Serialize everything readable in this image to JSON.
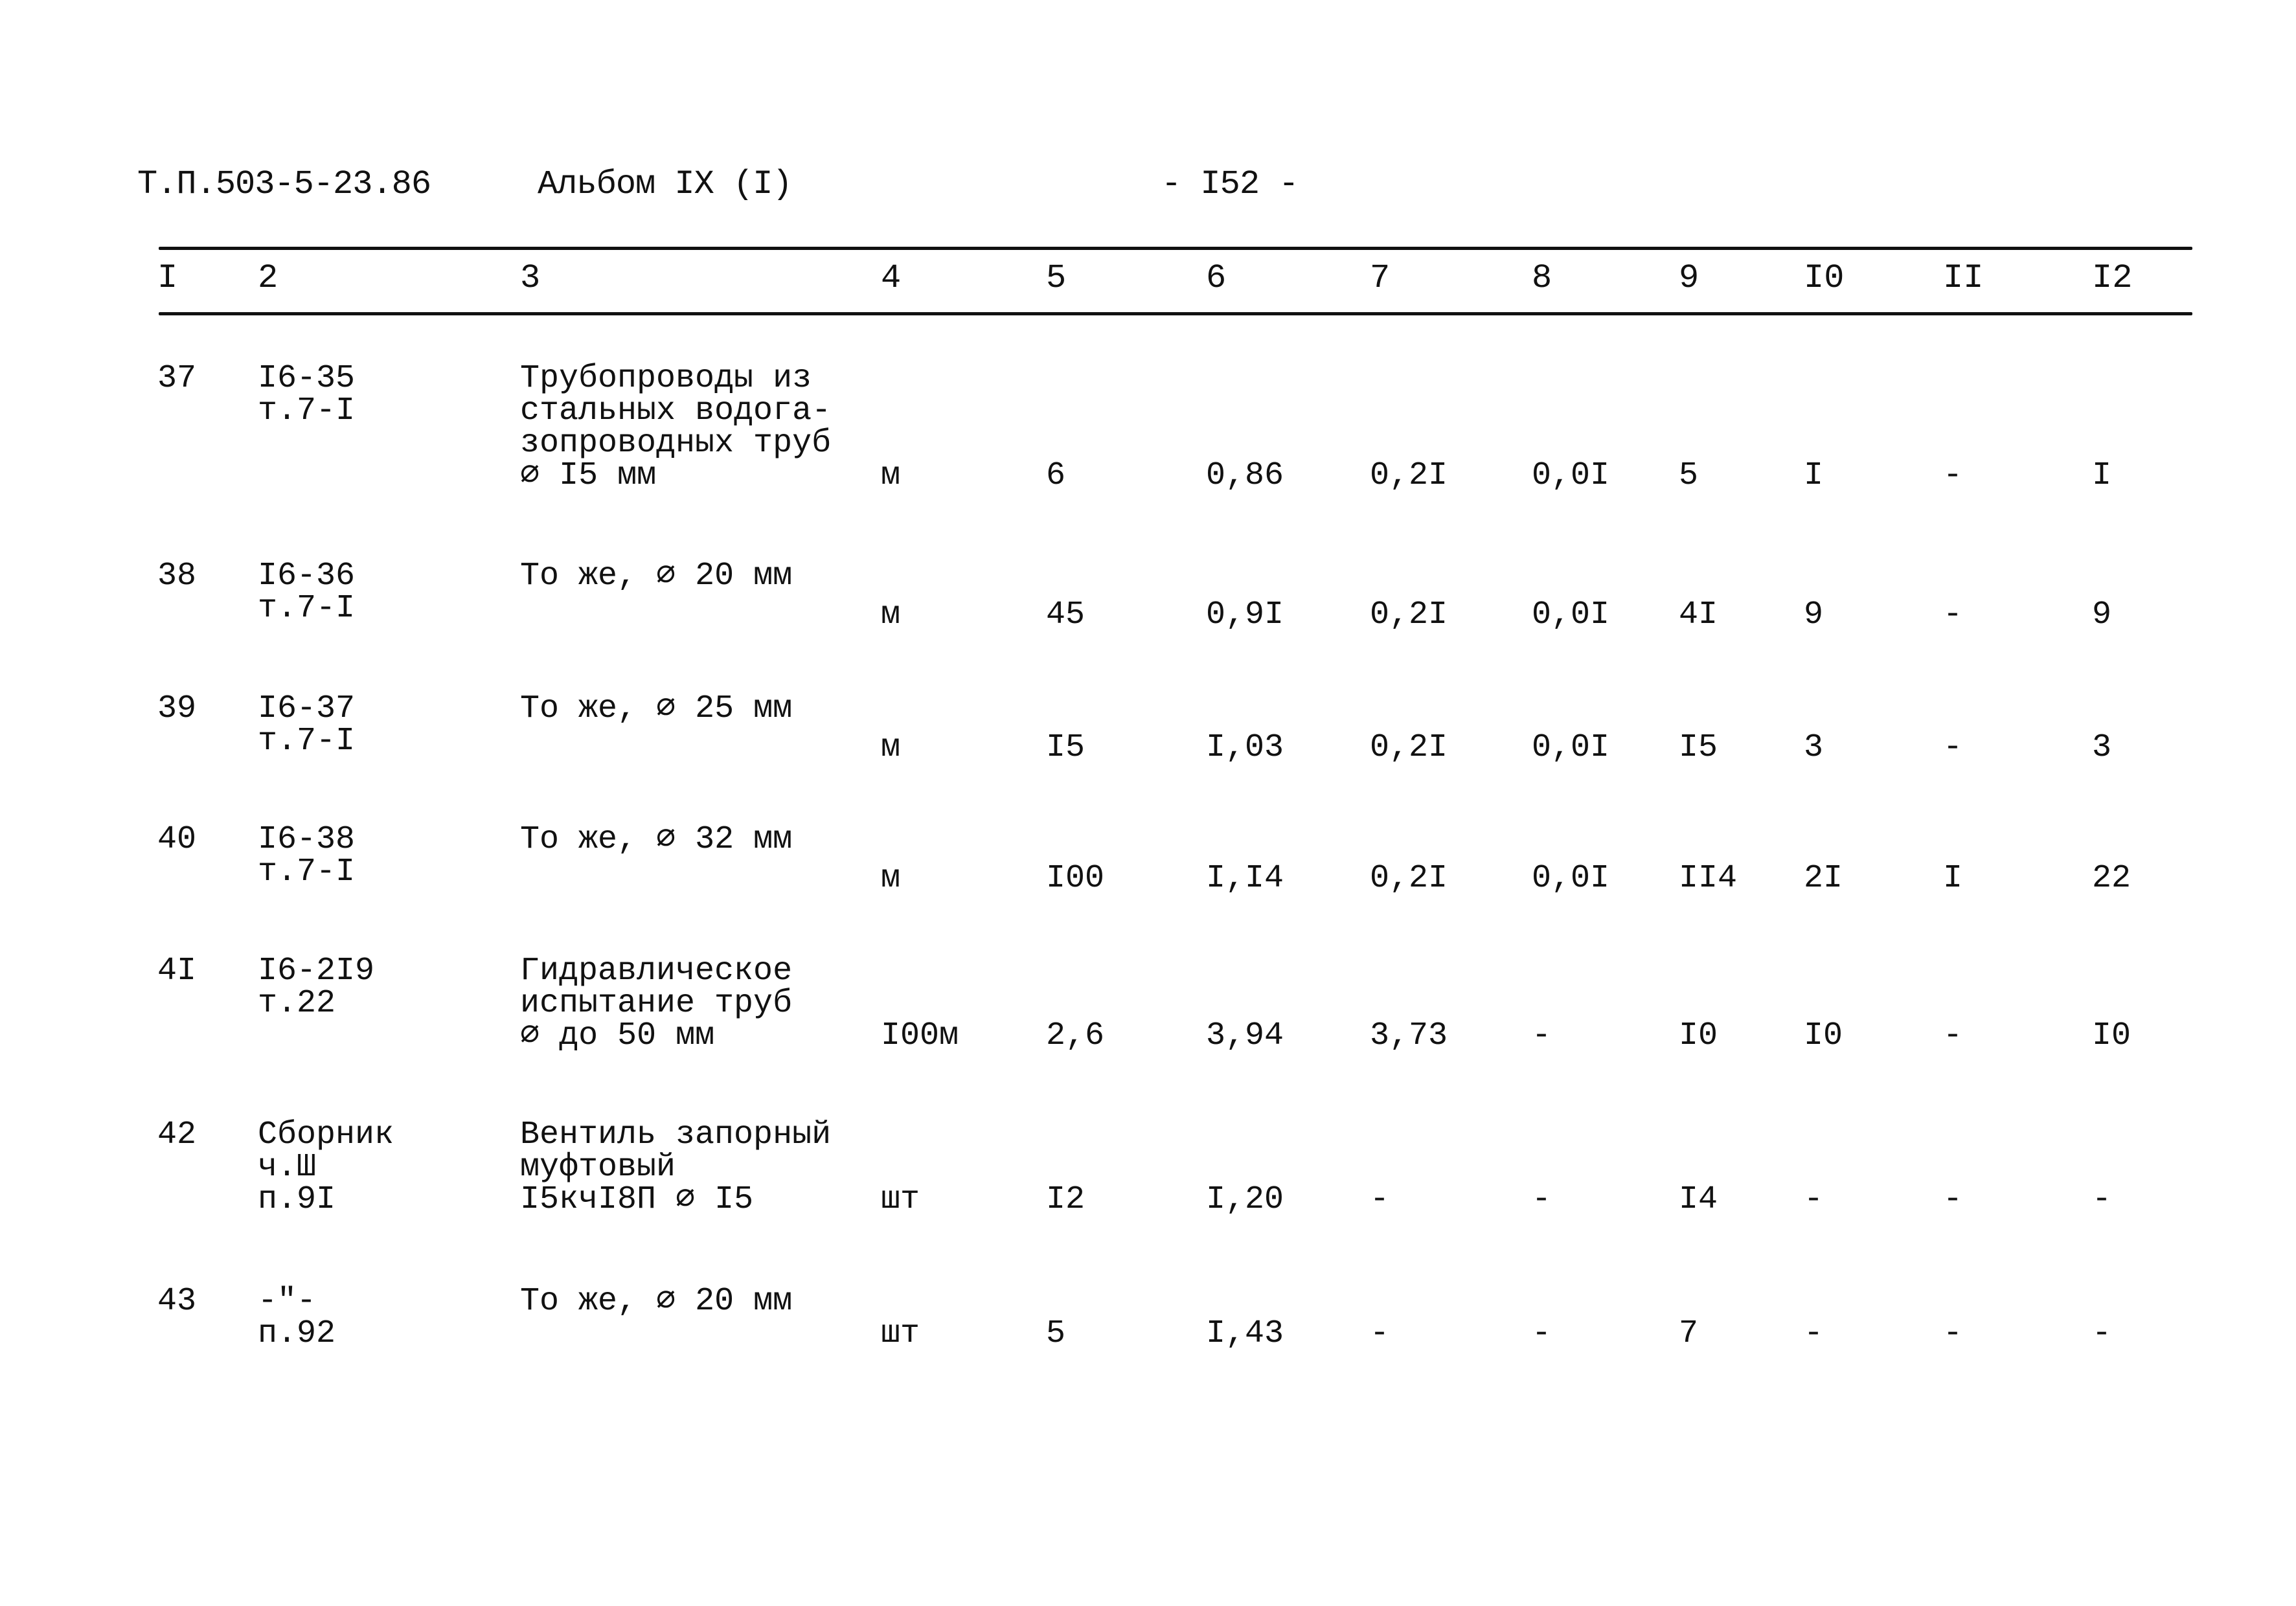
{
  "header": {
    "code": "Т.П.503-5-23.86",
    "album": "Альбом IX (I)",
    "page": "- I52 -"
  },
  "table": {
    "columns": [
      "I",
      "2",
      "3",
      "4",
      "5",
      "6",
      "7",
      "8",
      "9",
      "I0",
      "II",
      "I2"
    ],
    "rows": [
      {
        "num": "37",
        "ref": [
          "I6-35",
          "т.7-I"
        ],
        "name": [
          "Трубопроводы из",
          "стальных водога-",
          "зопроводных труб",
          "⌀ I5 мм"
        ],
        "unit": "м",
        "c5": "6",
        "c6": "0,86",
        "c7": "0,2I",
        "c8": "0,0I",
        "c9": "5",
        "c10": "I",
        "c11": "-",
        "c12": "I"
      },
      {
        "num": "38",
        "ref": [
          "I6-36",
          "т.7-I"
        ],
        "name": [
          "То же, ⌀ 20 мм"
        ],
        "unit": "м",
        "c5": "45",
        "c6": "0,9I",
        "c7": "0,2I",
        "c8": "0,0I",
        "c9": "4I",
        "c10": "9",
        "c11": "-",
        "c12": "9"
      },
      {
        "num": "39",
        "ref": [
          "I6-37",
          "т.7-I"
        ],
        "name": [
          "То же, ⌀ 25 мм"
        ],
        "unit": "м",
        "c5": "I5",
        "c6": "I,03",
        "c7": "0,2I",
        "c8": "0,0I",
        "c9": "I5",
        "c10": "3",
        "c11": "-",
        "c12": "3"
      },
      {
        "num": "40",
        "ref": [
          "I6-38",
          "т.7-I"
        ],
        "name": [
          "То же, ⌀ 32 мм"
        ],
        "unit": "м",
        "c5": "I00",
        "c6": "I,I4",
        "c7": "0,2I",
        "c8": "0,0I",
        "c9": "II4",
        "c10": "2I",
        "c11": "I",
        "c12": "22"
      },
      {
        "num": "4I",
        "ref": [
          "I6-2I9",
          "т.22"
        ],
        "name": [
          "Гидравлическое",
          "испытание труб",
          "⌀ до 50 мм"
        ],
        "unit": "I00м",
        "c5": "2,6",
        "c6": "3,94",
        "c7": "3,73",
        "c8": "-",
        "c9": "I0",
        "c10": "I0",
        "c11": "-",
        "c12": "I0"
      },
      {
        "num": "42",
        "ref": [
          "Сборник",
          "ч.Ш",
          "п.9I"
        ],
        "name": [
          "Вентиль запорный",
          "муфтовый",
          "I5кчI8П ⌀ I5"
        ],
        "unit": "шт",
        "c5": "I2",
        "c6": "I,20",
        "c7": "-",
        "c8": "-",
        "c9": "I4",
        "c10": "-",
        "c11": "-",
        "c12": "-"
      },
      {
        "num": "43",
        "ref": [
          "-\"-",
          "п.92"
        ],
        "name": [
          "То же, ⌀ 20 мм"
        ],
        "unit": "шт",
        "c5": "5",
        "c6": "I,43",
        "c7": "-",
        "c8": "-",
        "c9": "7",
        "c10": "-",
        "c11": "-",
        "c12": "-"
      }
    ]
  }
}
